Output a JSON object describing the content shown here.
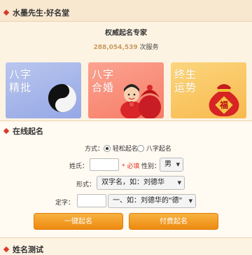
{
  "header": {
    "site_title": "水墨先生·好名堂"
  },
  "intro": {
    "expert_title": "权威起名专家",
    "service_count": "288,054,539",
    "service_suffix": "次服务"
  },
  "banners": [
    {
      "line1": "八字",
      "line2": "精批",
      "icon": "yin-yang-icon"
    },
    {
      "line1": "八字",
      "line2": "合婚",
      "icon": "bride-groom-icon"
    },
    {
      "line1": "终生",
      "line2": "运势",
      "icon": "lucky-bag-icon",
      "bag_char": "福"
    }
  ],
  "online_naming": {
    "section_title": "在线起名",
    "method_label": "方式：",
    "method_options": [
      "轻松起名",
      "八字起名"
    ],
    "surname_label": "姓氏：",
    "surname_value": "",
    "required_mark": "* 必填",
    "gender_label": "性别：",
    "gender_value": "男",
    "form_label": "形式：",
    "form_value": "双字名，如：刘德华",
    "fixed_char_label": "定字：",
    "fixed_char_value": "",
    "fixed_pos_value": "一、如：刘德华的\"德\"",
    "quick_button": "一键起名",
    "paid_button": "付费起名"
  },
  "next_section": {
    "title": "姓名测试"
  },
  "colors": {
    "accent_red": "#d83a2a",
    "button_orange": "#f29a24",
    "count_gold": "#c99a5e"
  }
}
